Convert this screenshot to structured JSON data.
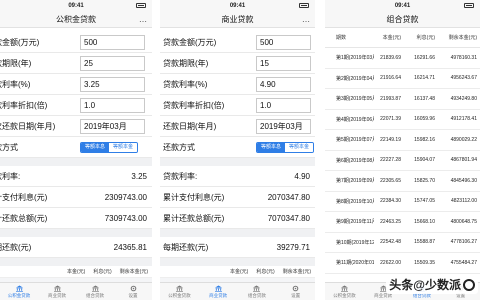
{
  "status_time": "09:41",
  "panel1": {
    "title": "公积金贷款",
    "fields": [
      {
        "label": "贷款金额(万元)",
        "value": "500"
      },
      {
        "label": "贷款期限(年)",
        "value": "25"
      },
      {
        "label": "贷款利率(%)",
        "value": "3.25"
      },
      {
        "label": "贷款利率折扣(倍)",
        "value": "1.0"
      },
      {
        "label": "首次还款日期(年月)",
        "value": "2019年03月"
      }
    ],
    "method_label": "还款方式",
    "method_options": [
      "等额本息",
      "等额本金"
    ],
    "results": [
      {
        "label": "贷款利率:",
        "value": "3.25"
      },
      {
        "label": "累计支付利息(元)",
        "value": "2309743.00"
      },
      {
        "label": "累计还款总额(元)",
        "value": "7309743.00"
      }
    ],
    "monthly_label": "每期还款(元)",
    "monthly_value": "24365.81",
    "table_cols": [
      "本金(元)",
      "利息(元)",
      "剩余本金(元)"
    ]
  },
  "panel2": {
    "title": "商业贷款",
    "fields": [
      {
        "label": "贷款金额(万元)",
        "value": "500"
      },
      {
        "label": "贷款期限(年)",
        "value": "15"
      },
      {
        "label": "贷款利率(%)",
        "value": "4.90"
      },
      {
        "label": "贷款利率折扣(倍)",
        "value": "1.0"
      },
      {
        "label": "还款日期(年月)",
        "value": "2019年03月"
      }
    ],
    "method_label": "还款方式",
    "method_options": [
      "等额本息",
      "等额本金"
    ],
    "results": [
      {
        "label": "贷款利率:",
        "value": "4.90"
      },
      {
        "label": "累计支付利息(元)",
        "value": "2070347.80"
      },
      {
        "label": "累计还款总额(元)",
        "value": "7070347.80"
      }
    ],
    "monthly_label": "每期还款(元)",
    "monthly_value": "39279.71",
    "table_cols": [
      "本金(元)",
      "利息(元)",
      "剩余本金(元)"
    ]
  },
  "panel3": {
    "title": "组合贷款",
    "columns": [
      "期数",
      "本金(元)",
      "利息(元)",
      "剩余本金(元)"
    ],
    "rows": [
      [
        "第1期(2019年03月)",
        "21839.69",
        "16291.66",
        "4978160.31"
      ],
      [
        "第2期(2019年04月)",
        "21916.64",
        "16214.71",
        "4956243.67"
      ],
      [
        "第3期(2019年05月)",
        "21993.87",
        "16137.48",
        "4934249.80"
      ],
      [
        "第4期(2019年06月)",
        "22071.39",
        "16059.96",
        "4912178.41"
      ],
      [
        "第5期(2019年07月)",
        "22149.19",
        "15982.16",
        "4890029.22"
      ],
      [
        "第6期(2019年08月)",
        "22227.28",
        "15904.07",
        "4867801.94"
      ],
      [
        "第7期(2019年09月)",
        "22305.65",
        "15825.70",
        "4845496.30"
      ],
      [
        "第8期(2019年10月)",
        "22384.30",
        "15747.05",
        "4823112.00"
      ],
      [
        "第9期(2019年11月)",
        "22463.25",
        "15668.10",
        "4800648.75"
      ],
      [
        "第10期(2019年12月)",
        "22542.48",
        "15588.87",
        "4778106.27"
      ],
      [
        "第11期(2020年01月)",
        "22622.00",
        "15509.35",
        "4755484.27"
      ]
    ]
  },
  "tabs": [
    "公积金贷款",
    "商业贷款",
    "组合贷款",
    "设置"
  ],
  "watermark": "头条@少数派",
  "colors": {
    "accent": "#2f7ee6",
    "page_bg": "#f4f5f7"
  }
}
